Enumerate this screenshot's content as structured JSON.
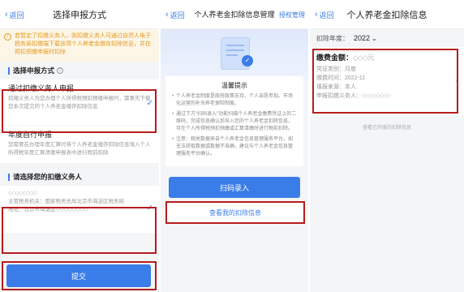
{
  "panel1": {
    "back": "返回",
    "title": "选择申报方式",
    "notice": "若暂定了扣缴义务人，则扣缴义务人可通过自然人电子税务局扣缴端下载该项个人养老金缴存扣除信息，并在预扣预缴申报时扣除",
    "section1": "选择申报方式",
    "option1": {
      "title": "通过扣缴义务人申报",
      "desc": "扣缴义务人为您办理个人所得税预扣预缴申报时，需事先下载您本次提交的个人养老金缴存扣除信息"
    },
    "option2": {
      "title": "年度自行申报",
      "desc": "您需要在办理年度汇算时将个人养老金缴存扣除信息填入个人所得税年度汇算清缴申报表中进行税前扣除"
    },
    "section2": "请选择您的扣缴义务人",
    "agent": {
      "name": "◇◇◇◇◇◇◇◇",
      "tax_office": "主管税务机关：国家税务总局北京市海淀区税务局",
      "address": "地址：北京市海淀区◇◇◇◇◇◇◇◇"
    },
    "submit": "提交"
  },
  "panel2": {
    "back": "返回",
    "title": "个人养老金扣除信息管理",
    "right": "授权管理",
    "tip_title": "温馨提示",
    "tips": [
      "个人养老金制度是政府政策支持、个人自愿参加、市场化运营的补充养老保险制度。",
      "通过下方\"扫码录入\"功能扫描个人养老金缴费凭证上的二维码，完成信息确认后导入您的个人养老金扣除信息，可在个人所得税预扣预缴或汇算清缴时进行税前扣除。",
      "注意：相关数据来自个人养老金信息管理服务平台，如无法获取数据或数据不准确，建议与个人养老金信息管理服务平台确认。"
    ],
    "scan_button": "扫码录入",
    "view_link": "查看我的扣除信息"
  },
  "panel3": {
    "back": "返回",
    "title": "个人养老金扣除信息",
    "year_label": "扣除年度：",
    "year_value": "2022",
    "amount_label": "缴费金额：",
    "amount_value": "◇◇◇元",
    "lines": [
      {
        "label": "凭证类别：",
        "value": "月度"
      },
      {
        "label": "缴费时间：",
        "value": "2022-11"
      },
      {
        "label": "填报来源：",
        "value": "本人"
      },
      {
        "label": "申报扣缴义务人：",
        "value": "◇◇◇◇◇◇◇◇"
      }
    ],
    "footer": "查看已作废的扣除信息"
  }
}
